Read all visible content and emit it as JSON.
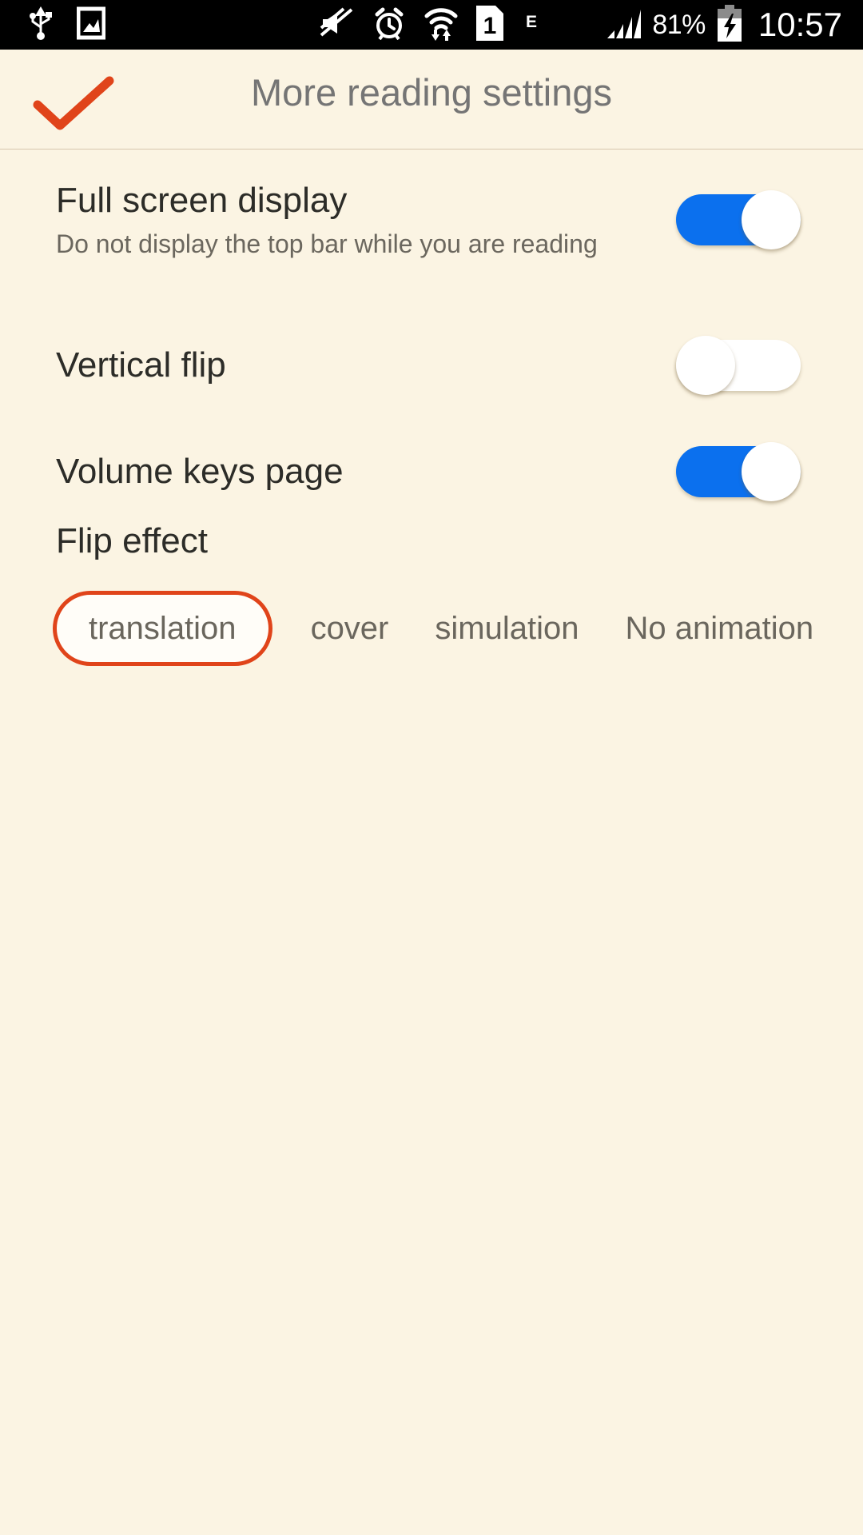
{
  "statusbar": {
    "icons_left": [
      "usb-icon",
      "screenshot-icon"
    ],
    "icons_mid": [
      "mute-icon",
      "alarm-icon",
      "wifi-transfer-icon",
      "sim1-icon"
    ],
    "network_type": "E",
    "signal": "signal-bars-icon",
    "battery_percent": "81%",
    "battery_state": "charging-battery-icon",
    "clock": "10:57"
  },
  "header": {
    "title": "More reading settings",
    "confirm_icon": "check-icon",
    "accent_color": "#E0441A",
    "title_color": "#757575"
  },
  "settings": {
    "rows": [
      {
        "title": "Full screen display",
        "subtitle": "Do not display the top bar while you are reading",
        "toggle": "on"
      },
      {
        "title": "Vertical flip",
        "subtitle": "",
        "toggle": "off"
      },
      {
        "title": "Volume keys page",
        "subtitle": "",
        "toggle": "on"
      }
    ]
  },
  "flip_effect": {
    "label": "Flip effect",
    "options": [
      {
        "label": "translation",
        "selected": true
      },
      {
        "label": "cover",
        "selected": false
      },
      {
        "label": "simulation",
        "selected": false
      },
      {
        "label": "No animation",
        "selected": false
      }
    ]
  },
  "colors": {
    "background": "#FBF4E3",
    "toggle_on": "#0B70EE",
    "accent": "#E0441A",
    "text_primary": "#2C2C28",
    "text_secondary": "#6B675E"
  }
}
